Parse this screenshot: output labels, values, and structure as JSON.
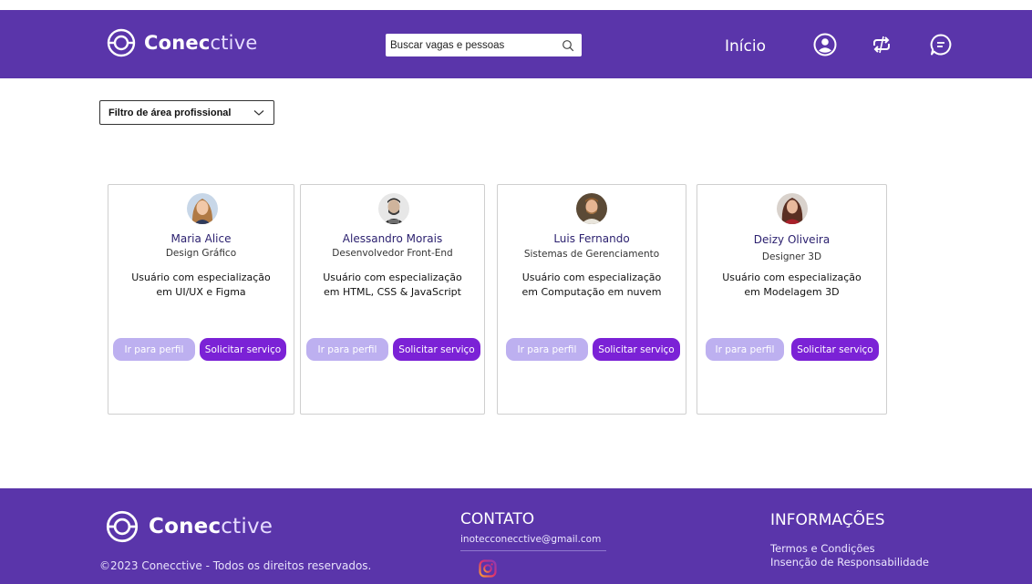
{
  "header": {
    "brand_bold": "Conec",
    "brand_thin": "ctive",
    "search_placeholder": "Buscar vagas e pessoas",
    "nav_home": "Início",
    "icons": [
      "search-icon",
      "user-profile-icon",
      "swap-icon",
      "chat-icon"
    ]
  },
  "filter": {
    "label": "Filtro de área profissional"
  },
  "cards": [
    {
      "name": "Maria Alice",
      "role": "Design Gráfico",
      "desc_line1": "Usuário com especialização",
      "desc_line2": "em UI/UX e Figma",
      "profile_btn": "Ir para perfil",
      "request_btn": "Solicitar serviço"
    },
    {
      "name": "Alessandro Morais",
      "role": "Desenvolvedor Front-End",
      "desc_line1": "Usuário com especialização",
      "desc_line2": "em HTML, CSS & JavaScript",
      "profile_btn": "Ir para perfil",
      "request_btn": "Solicitar serviço"
    },
    {
      "name": "Luis Fernando",
      "role": "Sistemas de Gerenciamento",
      "desc_line1": "Usuário com especialização",
      "desc_line2": "em Computação em nuvem",
      "profile_btn": "Ir para perfil",
      "request_btn": "Solicitar serviço"
    },
    {
      "name": "Deizy Oliveira",
      "role": "Designer 3D",
      "desc_line1": "Usuário com especialização",
      "desc_line2": "em Modelagem 3D",
      "profile_btn": "Ir para perfil",
      "request_btn": "Solicitar serviço"
    }
  ],
  "footer": {
    "brand_bold": "Conec",
    "brand_thin": "ctive",
    "copyright": "©2023 Conecctive - Todos os direitos reservados.",
    "contact_title": "CONTATO",
    "contact_email": "inotecconecctive@gmail.com",
    "info_title": "INFORMAÇÕES",
    "info_link1": "Termos e Condições",
    "info_link2": "Insenção de Responsabilidade",
    "social_icon": "instagram-icon"
  },
  "colors": {
    "brand_purple": "#5a35aa",
    "button_primary": "#7b22d6",
    "button_secondary": "#bdb0f0",
    "name_text": "#2a1f6e"
  }
}
